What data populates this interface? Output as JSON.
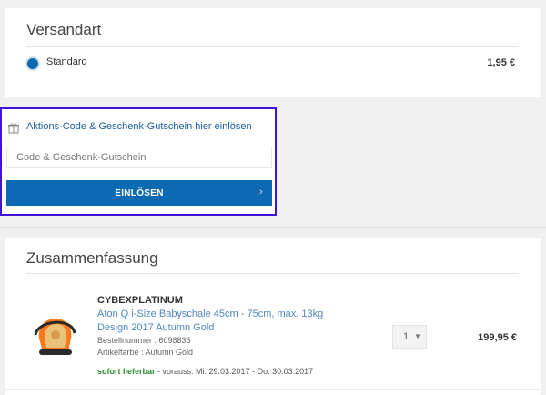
{
  "shipping": {
    "title": "Versandart",
    "option_label": "Standard",
    "option_price": "1,95 €"
  },
  "voucher": {
    "link_label": "Aktions-Code & Geschenk-Gutschein hier einlösen",
    "input_placeholder": "Code & Geschenk-Gutschein",
    "input_value": "",
    "button_label": "EINLÖSEN",
    "button_chevron": "›"
  },
  "summary": {
    "title": "Zusammenfassung",
    "item": {
      "brand": "CYBEXPLATINUM",
      "name_line1": "Aton Q i-Size Babyschale 45cm - 75cm, max. 13kg",
      "name_line2": "Design 2017 Autumn Gold",
      "order_number": "Bestellnummer : 6098835",
      "color": "Artikelfarbe : Autumn Gold",
      "quantity": "1",
      "quantity_arrow": "▼",
      "price": "199,95 €",
      "availability_status": "sofort lieferbar",
      "availability_detail": " - vorauss. Mi. 29.03.2017 - Do. 30.03.2017"
    }
  },
  "colors": {
    "accent_blue": "#0c6ab3",
    "link_blue": "#1a5fa0",
    "highlight_border": "#3f14d8",
    "available_green": "#2a8a2a"
  }
}
